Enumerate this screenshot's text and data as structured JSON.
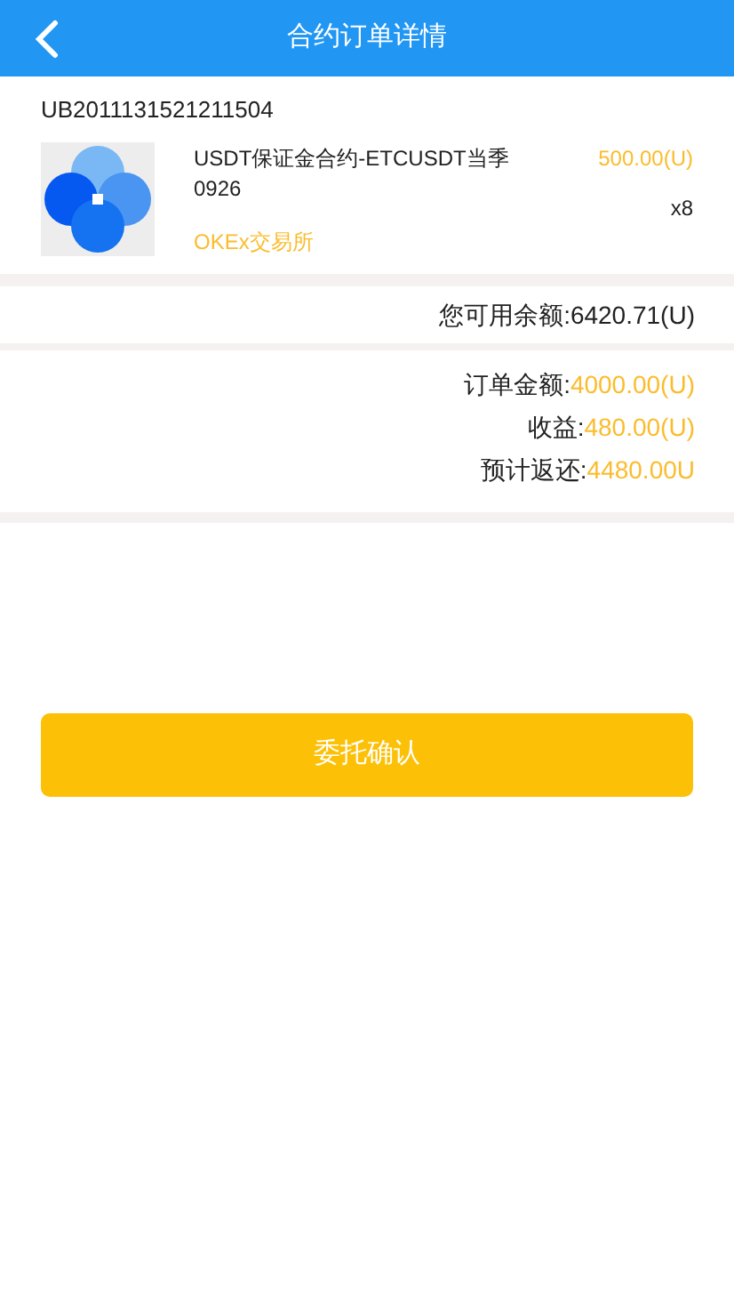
{
  "header": {
    "title": "合约订单详情"
  },
  "order": {
    "number": "UB2011131521211504",
    "product": "USDT保证金合约-ETCUSDT当季0926",
    "price": "500.00(U)",
    "quantity": "x8",
    "exchange": "OKEx交易所"
  },
  "balance": {
    "label": "您可用余额:",
    "value": "6420.71(U)"
  },
  "summary": [
    {
      "label": "订单金额:",
      "value": "4000.00(U)"
    },
    {
      "label": "收益:",
      "value": "480.00(U)"
    },
    {
      "label": "预计返还:",
      "value": "4480.00U"
    }
  ],
  "confirm_button": "委托确认"
}
